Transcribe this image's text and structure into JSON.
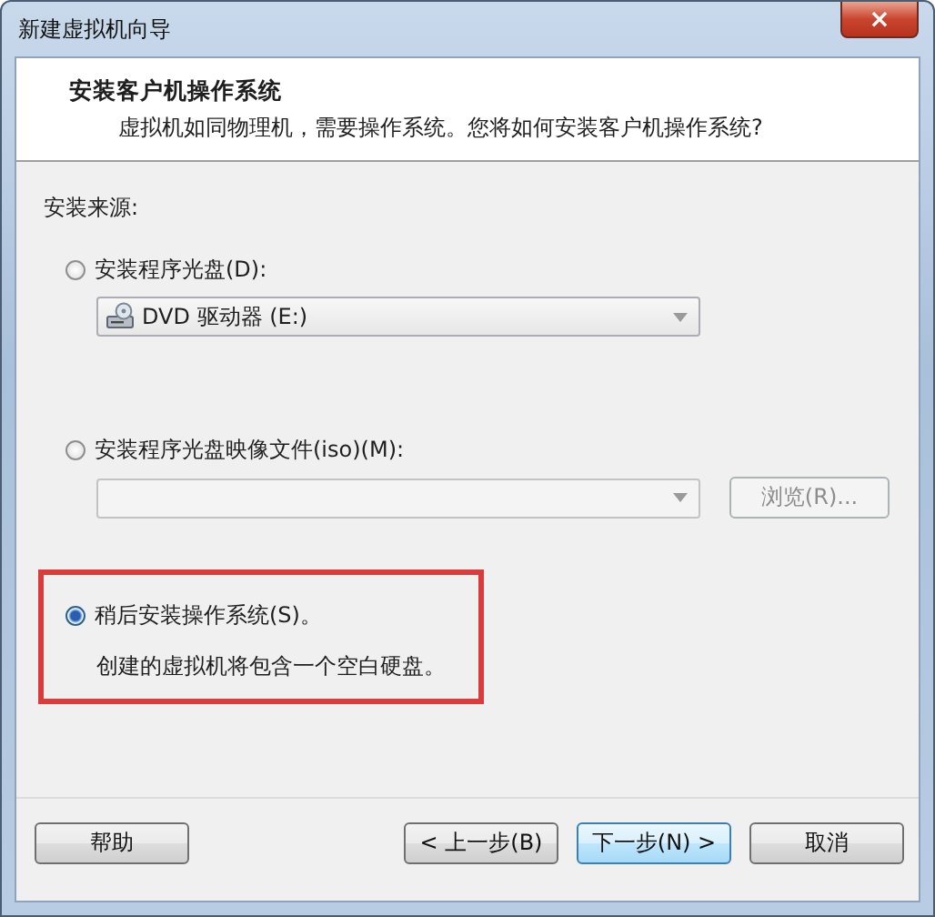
{
  "window": {
    "title": "新建虚拟机向导",
    "close": "×"
  },
  "header": {
    "title": "安装客户机操作系统",
    "subtitle": "虚拟机如同物理机，需要操作系统。您将如何安装客户机操作系统?"
  },
  "source_label": "安装来源:",
  "options": [
    {
      "kind": "disc",
      "label": "安装程序光盘(D):",
      "selected": false,
      "highlighted": false,
      "combo": {
        "value": "DVD 驱动器 (E:)",
        "disabled": false
      }
    },
    {
      "kind": "iso",
      "label": "安装程序光盘映像文件(iso)(M):",
      "selected": false,
      "highlighted": false,
      "combo": {
        "disabled": true
      },
      "browse_button": {
        "label": "浏览(R)...",
        "disabled": true
      }
    },
    {
      "kind": "later",
      "label": "稍后安装操作系统(S)。",
      "selected": true,
      "highlighted": true,
      "description": "创建的虚拟机将包含一个空白硬盘。"
    }
  ],
  "buttons": [
    {
      "label": "帮助",
      "default": false
    },
    {
      "label": "< 上一步(B)",
      "default": false
    },
    {
      "label": "下一步(N) >",
      "default": true
    },
    {
      "label": "取消",
      "default": false
    }
  ]
}
